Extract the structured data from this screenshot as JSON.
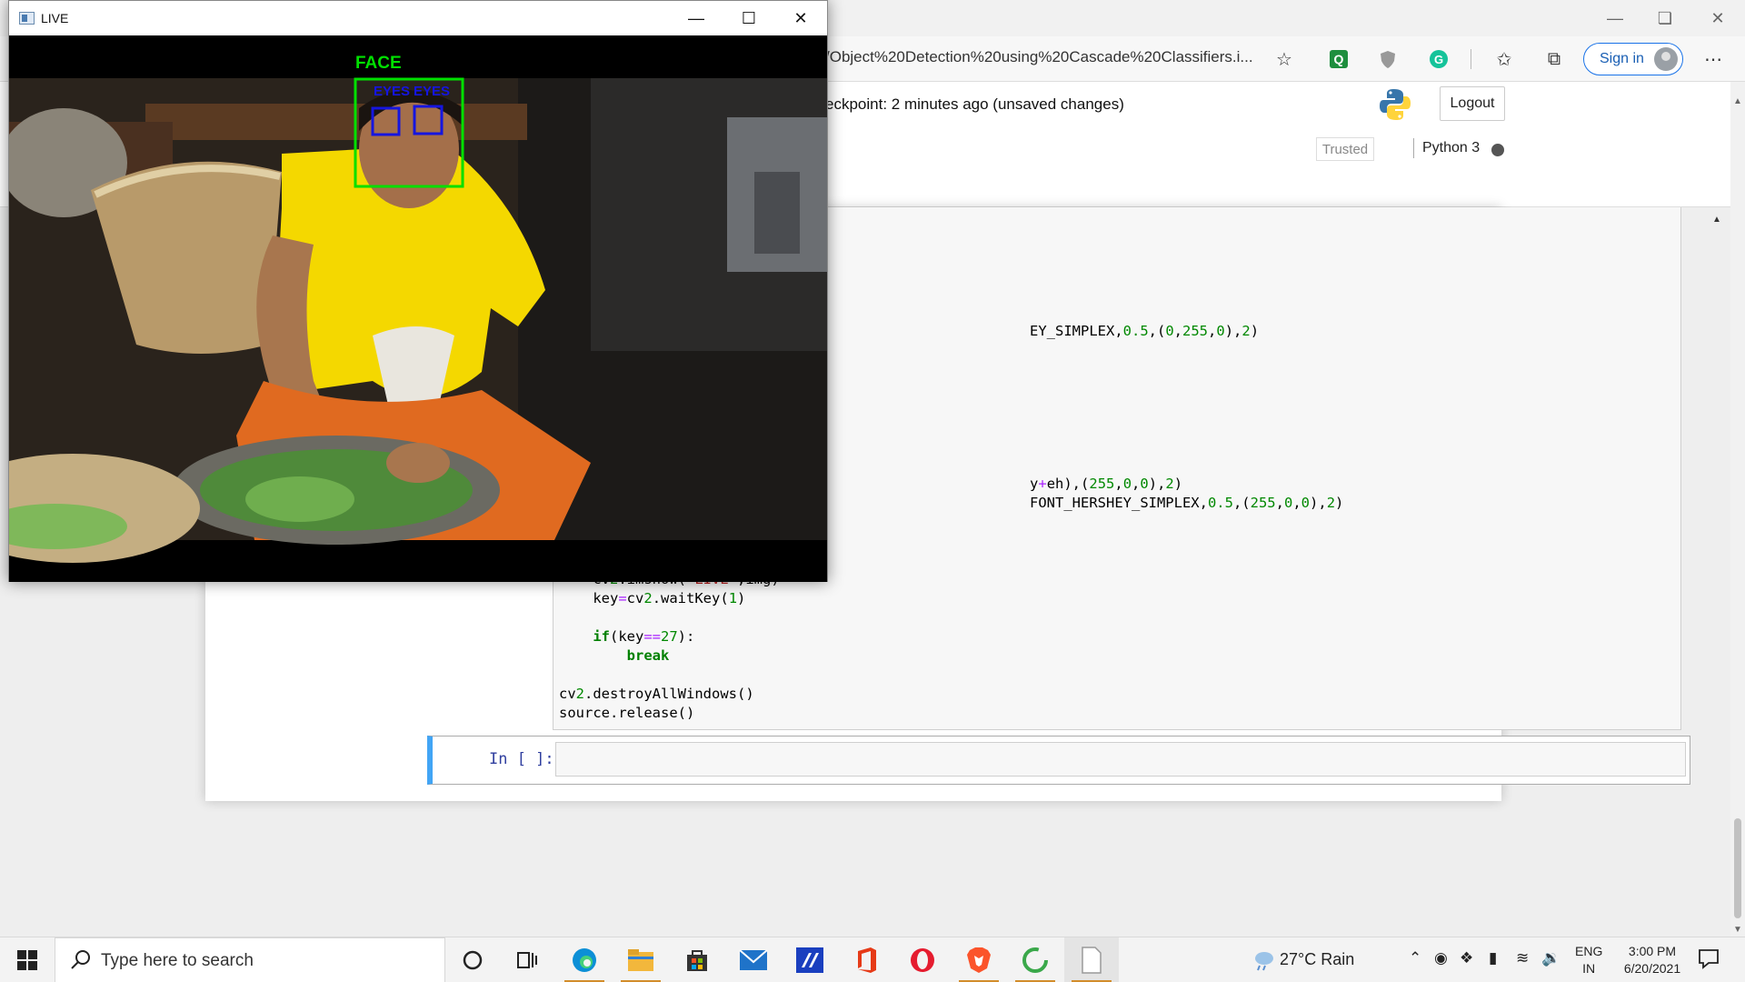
{
  "browser": {
    "address": "/Object%20Detection%20using%20Cascade%20Classifiers.i...",
    "sign_in": "Sign in"
  },
  "notebook": {
    "checkpoint": "eckpoint: 2 minutes ago  (unsaved changes)",
    "logout": "Logout",
    "trusted": "Trusted",
    "kernel": "Python 3",
    "prompt": "In [ ]:",
    "code_lines": [
      "EY_SIMPLEX,0.5,(0,255,0),2)",
      "y+eh),(255,0,0),2)",
      "FONT_HERSHEY_SIMPLEX,0.5,(255,0,0),2)",
      "    cv2.imshow('LIVE',img)",
      "    key=cv2.waitKey(1)",
      "    if(key==27):",
      "        break",
      "cv2.destroyAllWindows()",
      "source.release()"
    ]
  },
  "live_window": {
    "title": "LIVE",
    "face_label": "FACE",
    "eye_label_1": "EYES",
    "eye_label_2": "EYES"
  },
  "taskbar": {
    "search_placeholder": "Type here to search",
    "weather": "27°C  Rain",
    "lang_1": "ENG",
    "lang_2": "IN",
    "time": "3:00 PM",
    "date": "6/20/2021"
  },
  "colors": {
    "face_box": "#00e000",
    "eye_box": "#1515e0",
    "accent": "#1a73e8"
  }
}
